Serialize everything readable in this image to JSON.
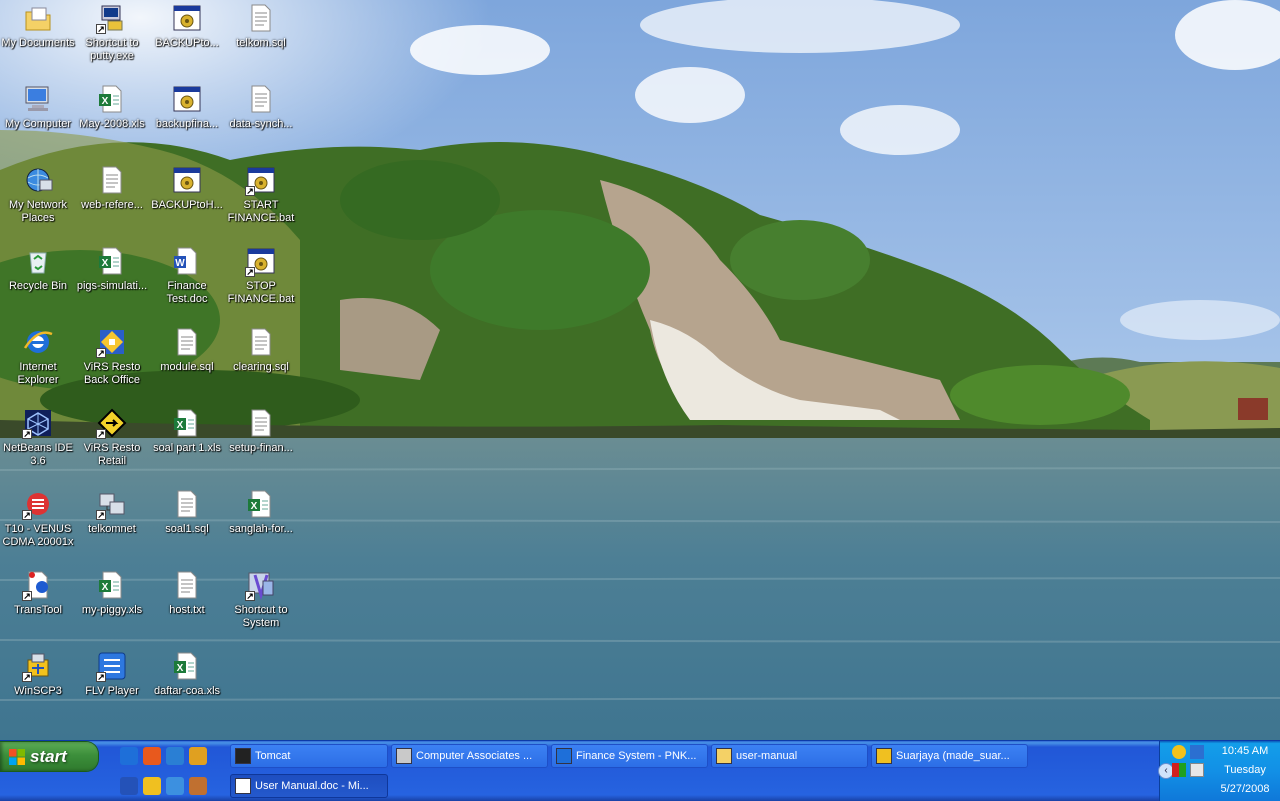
{
  "desktop": {
    "icons": [
      {
        "label": "My Documents",
        "icon": "my-documents-icon",
        "shortcut": false
      },
      {
        "label": "Shortcut to putty.exe",
        "icon": "putty-icon",
        "shortcut": true
      },
      {
        "label": "BACKUPto...",
        "icon": "batch-file-icon",
        "shortcut": false
      },
      {
        "label": "telkom.sql",
        "icon": "text-file-icon",
        "shortcut": false
      },
      {
        "label": "My Computer",
        "icon": "my-computer-icon",
        "shortcut": false
      },
      {
        "label": "May-2008.xls",
        "icon": "excel-file-icon",
        "shortcut": false
      },
      {
        "label": "backupfina...",
        "icon": "batch-file-icon",
        "shortcut": false
      },
      {
        "label": "data-synch...",
        "icon": "text-file-icon",
        "shortcut": false
      },
      {
        "label": "My Network Places",
        "icon": "network-places-icon",
        "shortcut": false
      },
      {
        "label": "web-refere...",
        "icon": "text-file-icon",
        "shortcut": false
      },
      {
        "label": "BACKUPtoH...",
        "icon": "batch-file-icon",
        "shortcut": false
      },
      {
        "label": "START FINANCE.bat",
        "icon": "batch-file-icon",
        "shortcut": true
      },
      {
        "label": "Recycle Bin",
        "icon": "recycle-bin-icon",
        "shortcut": false
      },
      {
        "label": "pigs-simulati...",
        "icon": "excel-file-icon",
        "shortcut": false
      },
      {
        "label": "Finance Test.doc",
        "icon": "word-file-icon",
        "shortcut": false
      },
      {
        "label": "STOP FINANCE.bat",
        "icon": "batch-file-icon",
        "shortcut": true
      },
      {
        "label": "Internet Explorer",
        "icon": "internet-explorer-icon",
        "shortcut": false
      },
      {
        "label": "ViRS Resto Back Office",
        "icon": "virs-backoffice-icon",
        "shortcut": true
      },
      {
        "label": "module.sql",
        "icon": "text-file-icon",
        "shortcut": false
      },
      {
        "label": "clearing.sql",
        "icon": "text-file-icon",
        "shortcut": false
      },
      {
        "label": "NetBeans IDE 3.6",
        "icon": "netbeans-icon",
        "shortcut": true
      },
      {
        "label": "ViRS Resto Retail",
        "icon": "virs-retail-icon",
        "shortcut": true
      },
      {
        "label": "soal part 1.xls",
        "icon": "excel-file-icon",
        "shortcut": false
      },
      {
        "label": "setup-finan...",
        "icon": "text-file-icon",
        "shortcut": false
      },
      {
        "label": "T10 - VENUS CDMA 20001x",
        "icon": "modem-icon",
        "shortcut": true
      },
      {
        "label": "telkomnet",
        "icon": "dialup-connection-icon",
        "shortcut": true
      },
      {
        "label": "soal1.sql",
        "icon": "text-file-icon",
        "shortcut": false
      },
      {
        "label": "sanglah-for...",
        "icon": "excel-file-icon",
        "shortcut": false
      },
      {
        "label": "TransTool",
        "icon": "transtool-icon",
        "shortcut": true
      },
      {
        "label": "my-piggy.xls",
        "icon": "excel-file-icon",
        "shortcut": false
      },
      {
        "label": "host.txt",
        "icon": "text-file-icon",
        "shortcut": false
      },
      {
        "label": "Shortcut to System",
        "icon": "system-shortcut-icon",
        "shortcut": true
      },
      {
        "label": "WinSCP3",
        "icon": "winscp-icon",
        "shortcut": true
      },
      {
        "label": "FLV Player",
        "icon": "flv-player-icon",
        "shortcut": true
      },
      {
        "label": "daftar-coa.xls",
        "icon": "excel-file-icon",
        "shortcut": false
      }
    ]
  },
  "taskbar": {
    "start_label": "start",
    "quick_launch": [
      {
        "icon": "internet-explorer-icon",
        "color": "#1e6fd9"
      },
      {
        "icon": "firefox-icon",
        "color": "#e8591d"
      },
      {
        "icon": "outlook-icon",
        "color": "#2a7fd4"
      },
      {
        "icon": "pencil-icon",
        "color": "#e0a020"
      },
      {
        "icon": "media-player-icon",
        "color": "#2452b8"
      },
      {
        "icon": "messenger-icon",
        "color": "#f0c020"
      },
      {
        "icon": "search-icon",
        "color": "#3c90e0"
      },
      {
        "icon": "tools-icon",
        "color": "#c07030"
      }
    ],
    "tasks": [
      {
        "label": "Tomcat",
        "icon": "console-icon",
        "active": false
      },
      {
        "label": "Computer Associates ...",
        "icon": "ca-icon",
        "active": false
      },
      {
        "label": "Finance System - PNK...",
        "icon": "internet-explorer-icon",
        "active": false
      },
      {
        "label": "user-manual",
        "icon": "folder-icon",
        "active": false
      },
      {
        "label": "Suarjaya (made_suar...",
        "icon": "messenger-icon",
        "active": false
      },
      {
        "label": "User Manual.doc - Mi...",
        "icon": "word-file-icon",
        "active": true
      }
    ],
    "tray": {
      "time": "10:45 AM",
      "day": "Tuesday",
      "date": "5/27/2008",
      "chevron": "‹",
      "icons": [
        "messenger-tray-icon",
        "network-tray-icon",
        "color-tray-icon",
        "shield-tray-icon"
      ]
    }
  },
  "colors": {
    "sky": "#8fb4e2",
    "sea": "#4d7f95",
    "hill": "#4a7a2c",
    "taskbar": "#2663e0",
    "start": "#3c8f3b"
  }
}
